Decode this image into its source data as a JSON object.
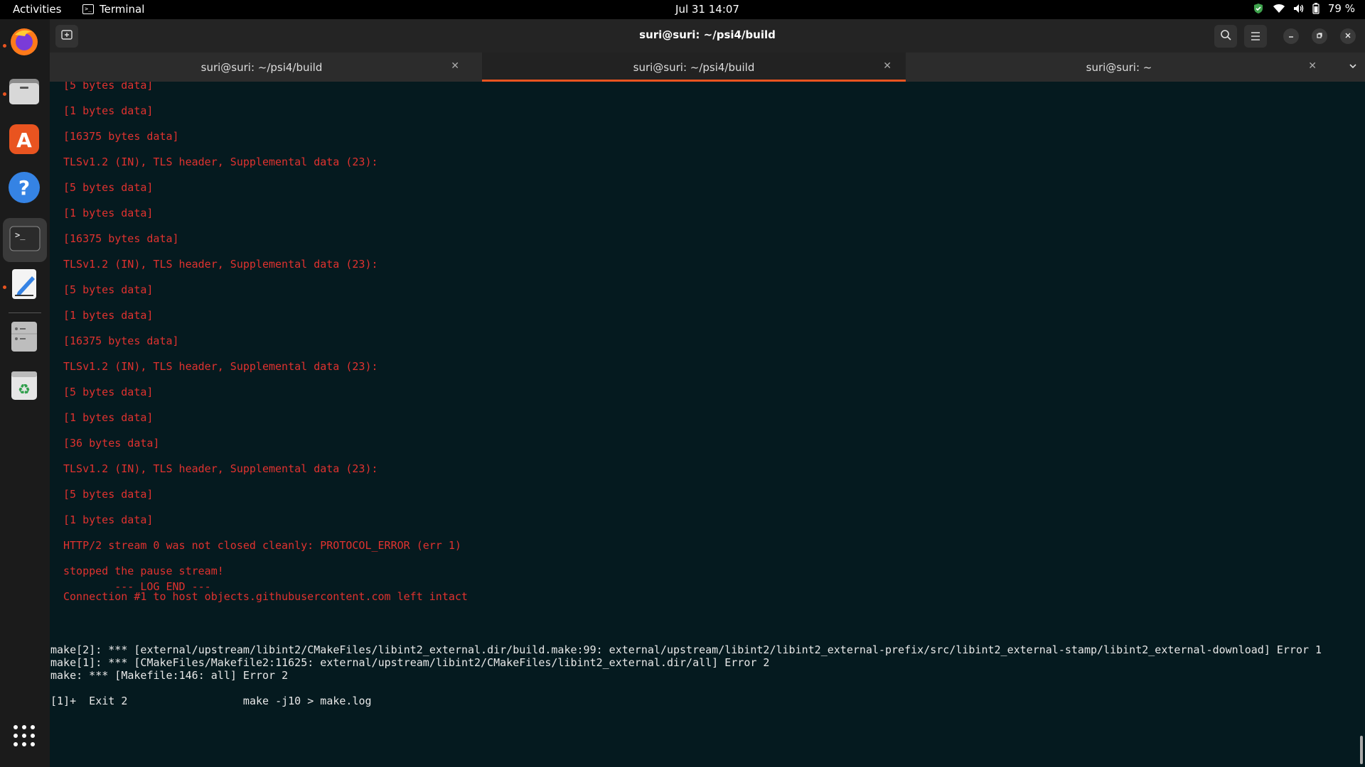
{
  "topbar": {
    "activities": "Activities",
    "app_name": "Terminal",
    "clock": "Jul 31  14:07",
    "battery": "79 %"
  },
  "dock": {
    "items": [
      {
        "name": "firefox",
        "running": true
      },
      {
        "name": "files",
        "running": true
      },
      {
        "name": "app-center",
        "running": false
      },
      {
        "name": "help",
        "running": false
      },
      {
        "name": "terminal",
        "running": true
      },
      {
        "name": "text-editor",
        "running": true
      },
      {
        "name": "disks",
        "running": false
      },
      {
        "name": "trash",
        "running": false
      }
    ]
  },
  "window": {
    "title": "suri@suri: ~/psi4/build",
    "tabs": [
      {
        "label": "suri@suri: ~/psi4/build",
        "active": false
      },
      {
        "label": "suri@suri: ~/psi4/build",
        "active": true
      },
      {
        "label": "suri@suri: ~",
        "active": false
      }
    ]
  },
  "terminal": {
    "red_lines": [
      "[5 bytes data]",
      "[1 bytes data]",
      "[16375 bytes data]",
      "TLSv1.2 (IN), TLS header, Supplemental data (23):",
      "[5 bytes data]",
      "[1 bytes data]",
      "[16375 bytes data]",
      "TLSv1.2 (IN), TLS header, Supplemental data (23):",
      "[5 bytes data]",
      "[1 bytes data]",
      "[16375 bytes data]",
      "TLSv1.2 (IN), TLS header, Supplemental data (23):",
      "[5 bytes data]",
      "[1 bytes data]",
      "[36 bytes data]",
      "TLSv1.2 (IN), TLS header, Supplemental data (23):",
      "[5 bytes data]",
      "[1 bytes data]",
      "HTTP/2 stream 0 was not closed cleanly: PROTOCOL_ERROR (err 1)",
      "stopped the pause stream!",
      "Connection #1 to host objects.githubusercontent.com left intact"
    ],
    "log_end": "        --- LOG END ---",
    "white_lines": [
      "make[2]: *** [external/upstream/libint2/CMakeFiles/libint2_external.dir/build.make:99: external/upstream/libint2/libint2_external-prefix/src/libint2_external-stamp/libint2_external-download] Error 1",
      "make[1]: *** [CMakeFiles/Makefile2:11625: external/upstream/libint2/CMakeFiles/libint2_external.dir/all] Error 2",
      "make: *** [Makefile:146: all] Error 2",
      "",
      "[1]+  Exit 2                  make -j10 > make.log"
    ]
  }
}
